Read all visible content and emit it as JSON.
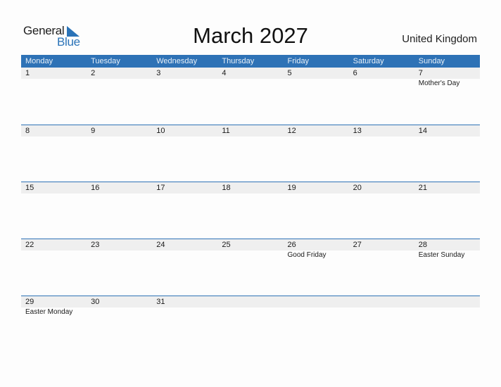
{
  "logo": {
    "part1": "General",
    "part2": "Blue"
  },
  "title": "March 2027",
  "country": "United Kingdom",
  "colors": {
    "accent": "#2e72b6",
    "strip": "#efefef"
  },
  "weekdays": [
    "Monday",
    "Tuesday",
    "Wednesday",
    "Thursday",
    "Friday",
    "Saturday",
    "Sunday"
  ],
  "weeks": [
    {
      "days": [
        "1",
        "2",
        "3",
        "4",
        "5",
        "6",
        "7"
      ],
      "events": [
        "",
        "",
        "",
        "",
        "",
        "",
        "Mother's Day"
      ]
    },
    {
      "days": [
        "8",
        "9",
        "10",
        "11",
        "12",
        "13",
        "14"
      ],
      "events": [
        "",
        "",
        "",
        "",
        "",
        "",
        ""
      ]
    },
    {
      "days": [
        "15",
        "16",
        "17",
        "18",
        "19",
        "20",
        "21"
      ],
      "events": [
        "",
        "",
        "",
        "",
        "",
        "",
        ""
      ]
    },
    {
      "days": [
        "22",
        "23",
        "24",
        "25",
        "26",
        "27",
        "28"
      ],
      "events": [
        "",
        "",
        "",
        "",
        "Good Friday",
        "",
        "Easter Sunday"
      ]
    },
    {
      "days": [
        "29",
        "30",
        "31",
        "",
        "",
        "",
        ""
      ],
      "events": [
        "Easter Monday",
        "",
        "",
        "",
        "",
        "",
        ""
      ]
    }
  ]
}
